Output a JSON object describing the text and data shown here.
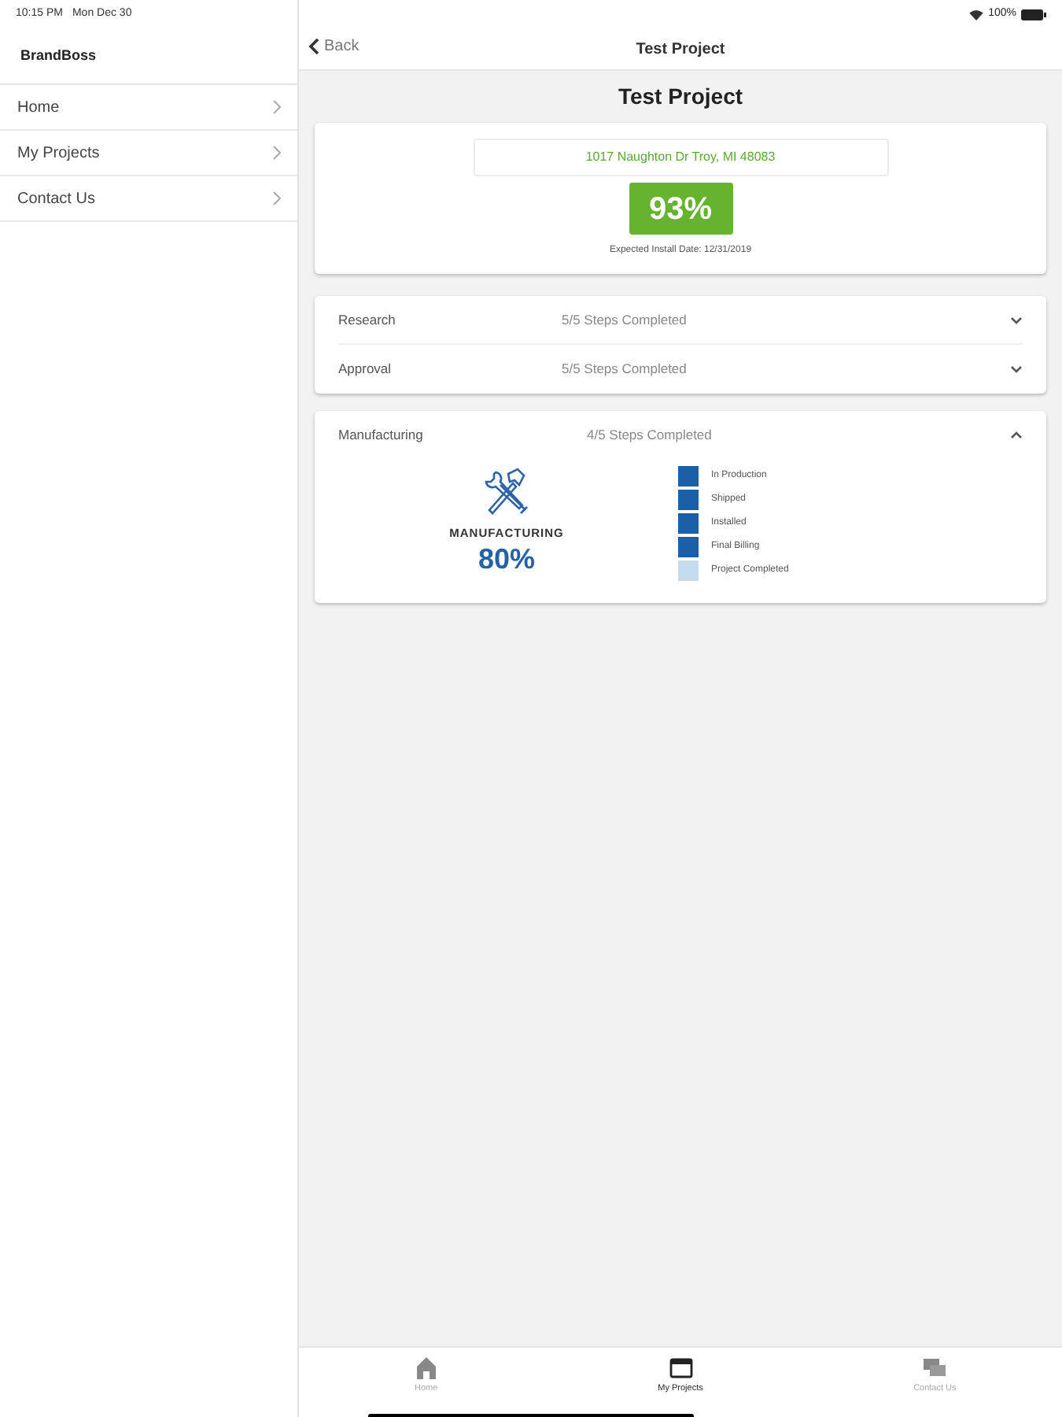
{
  "status_bar": {
    "time": "10:15 PM",
    "date": "Mon Dec 30",
    "battery": "100%"
  },
  "sidebar": {
    "title": "BrandBoss",
    "items": [
      {
        "label": "Home"
      },
      {
        "label": "My Projects"
      },
      {
        "label": "Contact Us"
      }
    ]
  },
  "nav_bar": {
    "back": "Back",
    "title": "Test Project"
  },
  "project": {
    "title": "Test Project",
    "address": "1017 Naughton Dr Troy, MI 48083",
    "percent": "93%",
    "install_date": "Expected Install Date: 12/31/2019"
  },
  "phase_groups": [
    {
      "phases": [
        {
          "name": "Research",
          "progress": "5/5 Steps Completed",
          "expanded": false
        },
        {
          "name": "Approval",
          "progress": "5/5 Steps Completed",
          "expanded": false
        }
      ]
    },
    {
      "phases": [
        {
          "name": "Manufacturing",
          "progress": "4/5 Steps Completed",
          "expanded": true,
          "stage_label": "MANUFACTURING",
          "stage_percent": "80%",
          "steps": [
            {
              "label": "In Production",
              "done": true
            },
            {
              "label": "Shipped",
              "done": true
            },
            {
              "label": "Installed",
              "done": true
            },
            {
              "label": "Final Billing",
              "done": true
            },
            {
              "label": "Project Completed",
              "done": false
            }
          ]
        }
      ]
    }
  ],
  "tab_bar": [
    {
      "label": "Home",
      "kind": "home",
      "selected": false
    },
    {
      "label": "My Projects",
      "kind": "projects",
      "selected": true
    },
    {
      "label": "Contact Us",
      "kind": "contact",
      "selected": false
    }
  ]
}
